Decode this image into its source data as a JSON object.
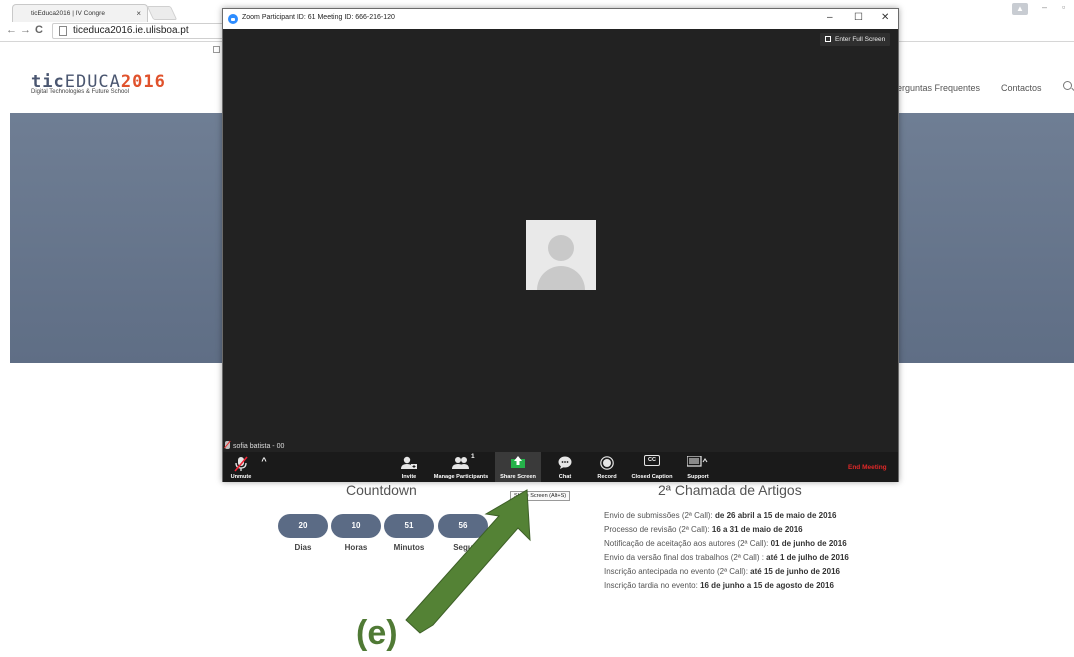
{
  "browser": {
    "tab_title": "ticEduca2016 | IV Congre",
    "tab_close": "×",
    "url": "ticeduca2016.ie.ulisboa.pt",
    "back": "←",
    "forward": "→",
    "reload": "C"
  },
  "site": {
    "logo_part1": "tic",
    "logo_part2": "EDUCA",
    "logo_part3": "2016",
    "logo_sub": "Digital Technologies & Future School",
    "nav": [
      "erguntas Frequentes",
      "Contactos"
    ],
    "countdown_title": "Countdown",
    "countdown": [
      {
        "value": "20",
        "label": "Dias"
      },
      {
        "value": "10",
        "label": "Horas"
      },
      {
        "value": "51",
        "label": "Minutos"
      },
      {
        "value": "56",
        "label": "Segu"
      }
    ],
    "call_title": "2ª Chamada de Artigos",
    "call_items": [
      {
        "text": "Envio de submissões (2ª Call): ",
        "bold": "de 26 abril a 15 de maio de 2016"
      },
      {
        "text": "Processo de revisão (2ª Call): ",
        "bold": "16  a 31 de maio de 2016"
      },
      {
        "text": "Notificação de aceitação aos autores (2ª Call):  ",
        "bold": "01 de junho de 2016"
      },
      {
        "text": "Envio da versão final dos trabalhos (2ª Call) : ",
        "bold": "até 1 de julho de 2016"
      },
      {
        "text": "Inscrição antecipada no evento (2ª Call): ",
        "bold": "até 15 de junho de 2016"
      },
      {
        "text": "Inscrição tardia no evento: ",
        "bold": "16 de junho a 15 de agosto de 2016"
      }
    ]
  },
  "zoom": {
    "title": "Zoom Participant ID: 61   Meeting ID: 666-216-120",
    "minimize": "–",
    "maximize": "☐",
    "close": "✕",
    "fullscreen": "Enter Full Screen",
    "participant_name": "sofia batista - 00",
    "participant_count": "1",
    "toolbar": {
      "unmute": "Unmute",
      "caret": "^",
      "invite": "Invite",
      "manage": "Manage Participants",
      "share": "Share Screen",
      "chat": "Chat",
      "record": "Record",
      "cc": "Closed Caption",
      "cc_badge": "CC",
      "support": "Support",
      "end": "End Meeting"
    },
    "tooltip": "Share Screen (Alt+S)"
  },
  "annotation": {
    "label": "(e)",
    "color": "#507a35"
  }
}
